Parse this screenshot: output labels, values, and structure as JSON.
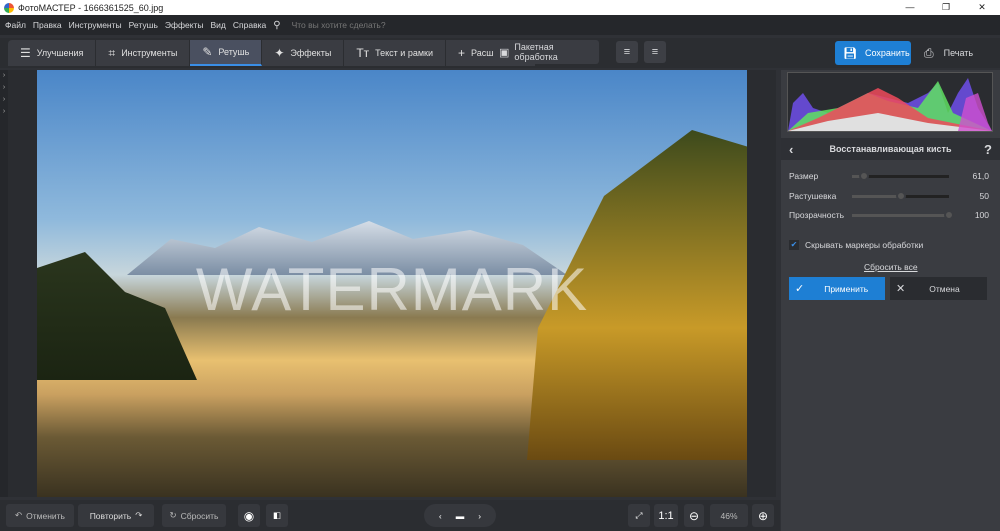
{
  "window": {
    "title": "ФотоМАСТЕР - 1666361525_60.jpg",
    "controls": [
      "—",
      "❐",
      "✕"
    ]
  },
  "menu": {
    "items": [
      "Файл",
      "Правка",
      "Инструменты",
      "Ретушь",
      "Эффекты",
      "Вид",
      "Справка"
    ],
    "search_placeholder": "Что вы хотите сделать?"
  },
  "tabs": [
    {
      "label": "Улучшения",
      "icon": "☰"
    },
    {
      "label": "Инструменты",
      "icon": "⌗"
    },
    {
      "label": "Ретушь",
      "icon": "✎"
    },
    {
      "label": "Эффекты",
      "icon": "✦"
    },
    {
      "label": "Текст и рамки",
      "icon": "Tт"
    },
    {
      "label": "Расширения",
      "icon": "+"
    }
  ],
  "batch_label": "Пакетная обработка",
  "save_label": "Сохранить",
  "print_label": "Печать",
  "watermark": "WATERMARK",
  "panel": {
    "title": "Восстанавливающая кисть",
    "help": "?",
    "sliders": [
      {
        "label": "Размер",
        "value": "61,0",
        "fraction": 0.12
      },
      {
        "label": "Растушевка",
        "value": "50",
        "fraction": 0.5
      },
      {
        "label": "Прозрачность",
        "value": "100",
        "fraction": 1.0
      }
    ],
    "hide_markers": "Скрывать маркеры обработки",
    "hide_markers_checked": true,
    "reset_all": "Сбросить все",
    "apply": "Применить",
    "cancel": "Отмена"
  },
  "bottom": {
    "undo": "Отменить",
    "redo": "Повторить",
    "reset": "Сбросить",
    "one_to_one": "1:1",
    "zoom": "46%"
  }
}
